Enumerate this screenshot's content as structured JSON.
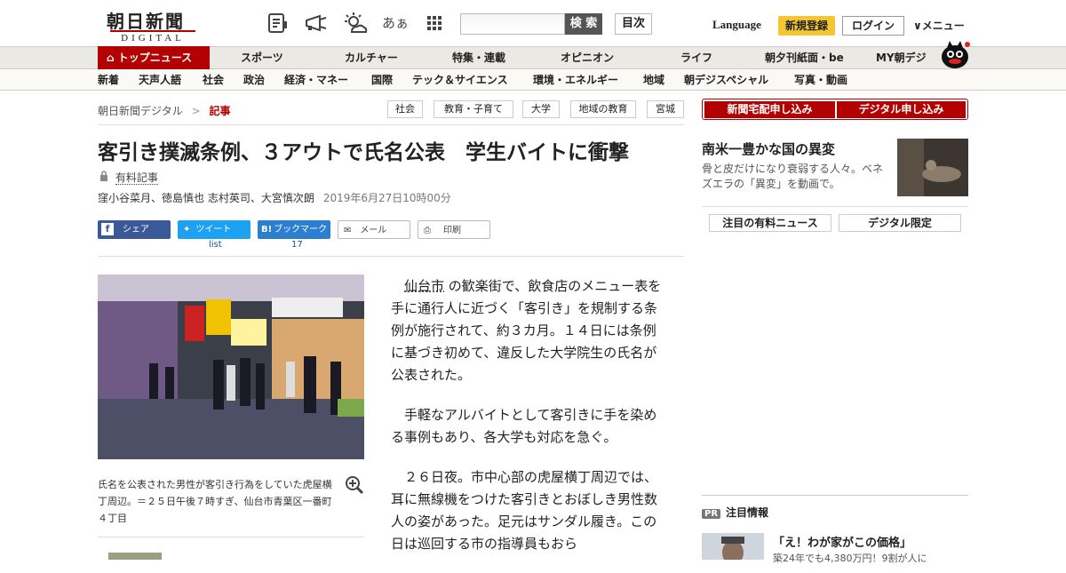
{
  "header": {
    "logo_top": "朝日新聞",
    "logo_bottom": "DIGITAL",
    "icons": [
      "newspaper-icon",
      "megaphone-icon",
      "weather-icon",
      "font-size-icon",
      "grid-icon"
    ],
    "font_size_label": "あぁ",
    "search_placeholder": "",
    "search_button": "検 索",
    "toc_button": "目次",
    "language": "Language",
    "register": "新規登録",
    "login": "ログイン",
    "menu": "メニュー"
  },
  "nav_primary": [
    "トップニュース",
    "スポーツ",
    "カルチャー",
    "特集・連載",
    "オピニオン",
    "ライフ",
    "朝夕刊紙面・be",
    "MY朝デジ"
  ],
  "nav_secondary": [
    "新着",
    "天声人語",
    "社会",
    "政治",
    "経済・マネー",
    "国際",
    "テック＆サイエンス",
    "環境・エネルギー",
    "地域",
    "朝デジスペシャル",
    "写真・動画"
  ],
  "breadcrumb": {
    "home": "朝日新聞デジタル",
    "sep": ">",
    "current": "記事"
  },
  "tags": [
    "社会",
    "教育・子育て",
    "大学",
    "地域の教育",
    "宮城"
  ],
  "article": {
    "title": "客引き撲滅条例、３アウトで氏名公表　学生バイトに衝撃",
    "paid_label": "有料記事",
    "authors": "窪小谷菜月、徳島慎也 志村英司、大宮慎次朗",
    "date": "2019年6月27日10時00分",
    "share": {
      "facebook": "シェア",
      "twitter": "ツイート",
      "hatena": "ブックマーク",
      "mail": "メール",
      "print": "印刷"
    },
    "twitter_count": "list",
    "hatena_count": "17",
    "caption": "氏名を公表された男性が客引き行為をしていた虎屋横丁周辺。＝２５日午後７時すぎ、仙台市青葉区一番町４丁目",
    "p1_link": "仙台市",
    "p1_rest": "の歓楽街で、飲食店のメニュー表を手に通行人に近づく「客引き」を規制する条例が施行されて、約３カ月。１４日には条例に基づき初めて、違反した大学院生の氏名が公表された。",
    "p2": "手軽なアルバイトとして客引きに手を染める事例もあり、各大学も対応を急ぐ。",
    "p3": "２６日夜。市中心部の虎屋横丁周辺では、耳に無線機をつけた客引きとおぼしき男性数人の姿があった。足元はサンダル履き。この日は巡回する市の指導員もおら"
  },
  "sidebar": {
    "btn_home": "新聞宅配申し込み",
    "btn_digital": "デジタル申し込み",
    "feature_title": "南米一豊かな国の異変",
    "feature_sub": "骨と皮だけになり衰弱する人々。ベネズエラの「異変」を動画で。",
    "tab_paid": "注目の有料ニュース",
    "tab_digital": "デジタル限定",
    "pr_badge": "PR",
    "pr_heading": "注目情報",
    "pr_title": "「え！わが家がこの価格」",
    "pr_sub": "築24年でも4,380万円！9割が人に"
  },
  "colors": {
    "brand_red": "#b30000",
    "register_yellow": "#f5c634"
  }
}
